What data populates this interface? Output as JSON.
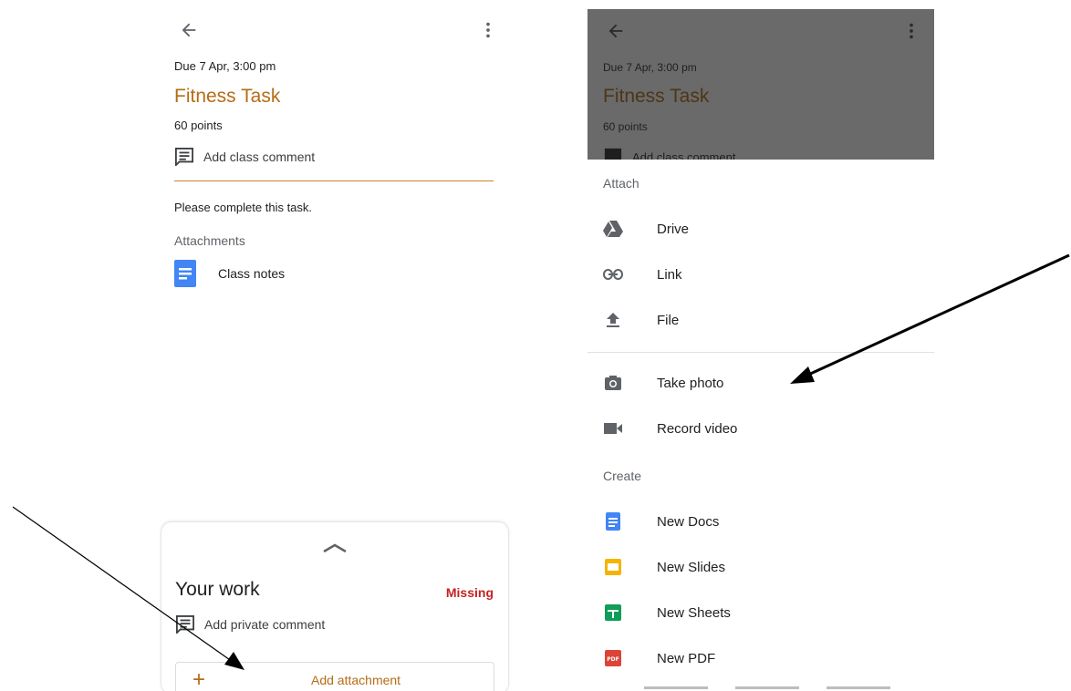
{
  "assignment": {
    "due": "Due 7 Apr, 3:00 pm",
    "title": "Fitness Task",
    "points": "60 points",
    "class_comment": "Add class comment",
    "instructions": "Please complete this task.",
    "attachments_heading": "Attachments",
    "attachment_name": "Class notes"
  },
  "your_work": {
    "title": "Your work",
    "status": "Missing",
    "private_comment": "Add private comment",
    "add_attachment": "Add attachment"
  },
  "attach_sheet": {
    "attach_heading": "Attach",
    "attach_items": [
      {
        "label": "Drive",
        "icon": "drive-icon"
      },
      {
        "label": "Link",
        "icon": "link-icon"
      },
      {
        "label": "File",
        "icon": "upload-icon"
      },
      {
        "label": "Take photo",
        "icon": "camera-icon"
      },
      {
        "label": "Record video",
        "icon": "video-icon"
      }
    ],
    "create_heading": "Create",
    "create_items": [
      {
        "label": "New Docs",
        "icon": "docs-icon",
        "color": "#4285f4"
      },
      {
        "label": "New Slides",
        "icon": "slides-icon",
        "color": "#f4b400"
      },
      {
        "label": "New Sheets",
        "icon": "sheets-icon",
        "color": "#0f9d58"
      },
      {
        "label": "New PDF",
        "icon": "pdf-icon",
        "color": "#db4437"
      }
    ]
  },
  "colors": {
    "accent": "#b66c15",
    "missing": "#c5221f",
    "overlay": "#6a6a6a"
  }
}
